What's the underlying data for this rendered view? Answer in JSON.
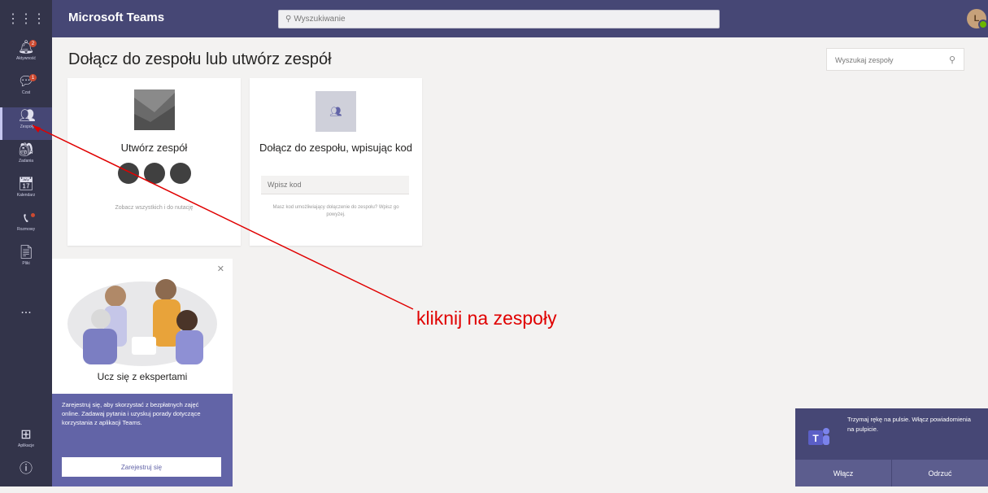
{
  "app": {
    "title": "Microsoft Teams",
    "avatar_initial": "L"
  },
  "search": {
    "placeholder": "Wyszukiwanie"
  },
  "rail": {
    "items": [
      {
        "label": "Aktywność",
        "badge": "2"
      },
      {
        "label": "Czat",
        "badge": "1"
      },
      {
        "label": "Zespoły"
      },
      {
        "label": "Zadania"
      },
      {
        "label": "Kalendarz"
      },
      {
        "label": "Rozmowy"
      },
      {
        "label": "Pliki"
      }
    ],
    "more": "...",
    "apps_label": "Aplikacje",
    "help_label": "Pomoc"
  },
  "page": {
    "title": "Dołącz do zespołu lub utwórz zespół",
    "team_search_placeholder": "Wyszukaj zespoły"
  },
  "create_card": {
    "title": "Utwórz zespół",
    "link": "Zobacz wszystkich i do nutację"
  },
  "join_card": {
    "title": "Dołącz do zespołu, wpisując kod",
    "code_placeholder": "Wpisz kod",
    "description": "Masz kod umożliwiający dołączenie do zespołu? Wpisz go powyżej."
  },
  "promo": {
    "title": "Ucz się z ekspertami",
    "text": "Zarejestruj się, aby skorzystać z bezpłatnych zajęć online. Zadawaj pytania i uzyskuj porady dotyczące korzystania z aplikacji Teams.",
    "button": "Zarejestruj się"
  },
  "annotation": {
    "text": "kliknij na zespoły",
    "color": "#e00000"
  },
  "toast": {
    "text": "Trzymaj rękę na pulsie. Włącz powiadomienia na pulpicie.",
    "enable": "Włącz",
    "dismiss": "Odrzuć"
  },
  "colors": {
    "brand": "#464775",
    "rail": "#33344a",
    "accent": "#6264a7"
  }
}
